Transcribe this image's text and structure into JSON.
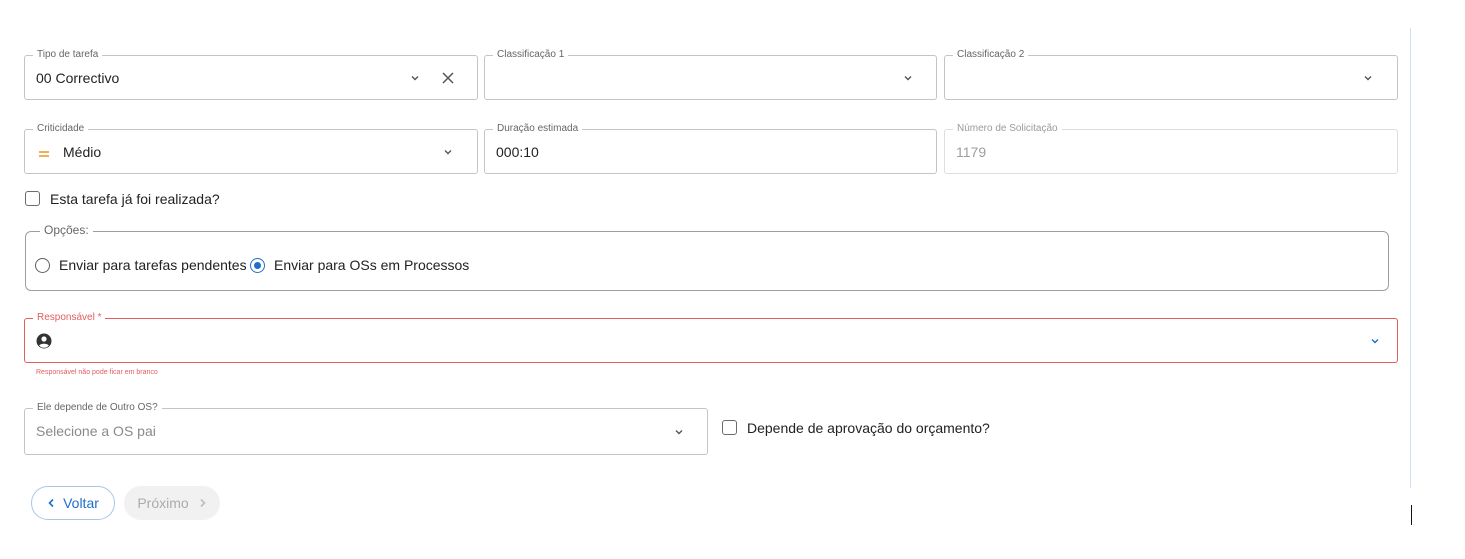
{
  "form": {
    "tipo_tarefa": {
      "label": "Tipo de tarefa",
      "value": "00 Correctivo"
    },
    "classificacao1": {
      "label": "Classificação 1",
      "value": ""
    },
    "classificacao2": {
      "label": "Classificação 2",
      "value": ""
    },
    "criticidade": {
      "label": "Criticidade",
      "value": "Médio",
      "icon": "equals-priority-icon",
      "icon_color": "#f0a23a"
    },
    "duracao": {
      "label": "Duração estimada",
      "value": "000:10"
    },
    "numero_solicitacao": {
      "label": "Número de Solicitação",
      "value": "1179"
    },
    "ja_realizada": {
      "label": "Esta tarefa já foi realizada?",
      "checked": false
    },
    "opcoes": {
      "legend": "Opções:",
      "options": [
        {
          "label": "Enviar para tarefas pendentes",
          "checked": false
        },
        {
          "label": "Enviar para OSs em Processos",
          "checked": true
        }
      ]
    },
    "responsavel": {
      "label": "Responsável *",
      "value": "",
      "error": "Responsável não pode ficar em branco",
      "error_color": "#e35d5d"
    },
    "depende_os": {
      "label": "Ele depende de Outro OS?",
      "placeholder": "Selecione a OS pai"
    },
    "aprovacao_orcamento": {
      "label": "Depende de aprovação do orçamento?",
      "checked": false
    }
  },
  "actions": {
    "back_label": "Voltar",
    "next_label": "Próximo",
    "accent": "#1f6fc9"
  }
}
